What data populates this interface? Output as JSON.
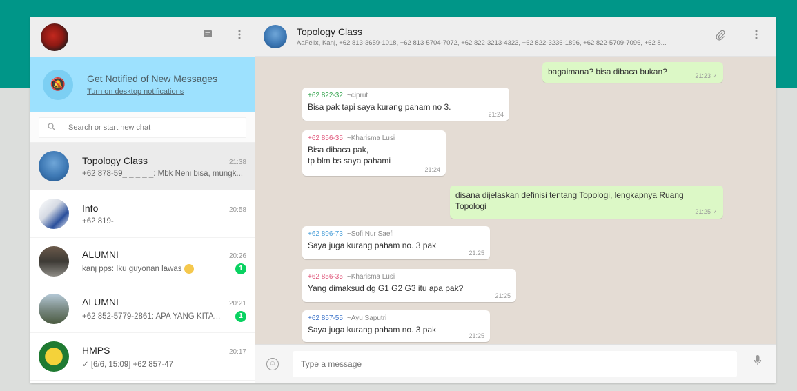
{
  "sidebar": {
    "notification": {
      "title": "Get Notified of New Messages",
      "subtitle": "Turn on desktop notifications"
    },
    "search": {
      "placeholder": "Search or start new chat"
    },
    "chats": [
      {
        "name": "Topology Class",
        "time": "21:38",
        "preview": "+62 878-59_ _ _ _ _: Mbk Neni bisa, mungk...",
        "badge": ""
      },
      {
        "name": "Info",
        "time": "20:58",
        "preview": "+62 819-",
        "badge": ""
      },
      {
        "name": "ALUMNI",
        "time": "20:26",
        "preview": "kanj pps: Iku guyonan lawas",
        "badge": "1"
      },
      {
        "name": "ALUMNI",
        "time": "20:21",
        "preview": "+62 852-5779-2861: APA YANG KITA...",
        "badge": "1"
      },
      {
        "name": "HMPS",
        "time": "20:17",
        "preview": "✓ [6/6, 15:09] +62 857-47",
        "badge": ""
      }
    ]
  },
  "conversation": {
    "title": "Topology Class",
    "members": "AaFélix, Kanj, +62 813-3659-1018, +62 813-5704-7072, +62 822-3213-4323, +62 822-3236-1896, +62 822-5709-7096, +62 8...",
    "messages": [
      {
        "dir": "out",
        "text": "bagaimana? bisa dibaca bukan?",
        "time": "21:23 ✓"
      },
      {
        "dir": "in",
        "number": "+62 822-32",
        "sender": "~ciprut",
        "text": "Bisa pak tapi saya kurang paham no 3.",
        "time": "21:24",
        "color": "#35a54f"
      },
      {
        "dir": "in",
        "number": "+62 856-35",
        "sender": "~Kharisma Lusi",
        "text": "Bisa dibaca pak,\ntp blm bs saya pahami",
        "time": "21:24",
        "color": "#e0577b"
      },
      {
        "dir": "out",
        "text": "disana dijelaskan definisi tentang Topologi, lengkapnya Ruang Topologi",
        "time": "21:25 ✓"
      },
      {
        "dir": "in",
        "number": "+62 896-73",
        "sender": "~Sofi Nur Saefi",
        "text": "Saya juga kurang paham no. 3 pak",
        "time": "21:25",
        "color": "#4a9fd9"
      },
      {
        "dir": "in",
        "number": "+62 856-35",
        "sender": "~Kharisma Lusi",
        "text": "Yang dimaksud dg G1 G2 G3 itu apa pak?",
        "time": "21:25",
        "color": "#e0577b"
      },
      {
        "dir": "in",
        "number": "+62 857-55",
        "sender": "~Ayu Saputri",
        "text": "Saya juga kurang paham no. 3 pak",
        "time": "21:25",
        "color": "#3a72c9"
      }
    ]
  },
  "compose": {
    "placeholder": "Type a message"
  },
  "icons": {
    "new_chat": "chat-icon",
    "menu": "kebab-menu-icon",
    "attach": "paperclip-icon",
    "emoji": "smiley-icon",
    "mic": "microphone-icon",
    "search": "search-icon",
    "notify": "bell-off-icon"
  },
  "colors": {
    "header_teal": "#009688",
    "notif_bg": "#9de1fe",
    "bubble_out": "#dcf8c6",
    "chat_bg": "#e4dcd4",
    "badge": "#09d261"
  }
}
